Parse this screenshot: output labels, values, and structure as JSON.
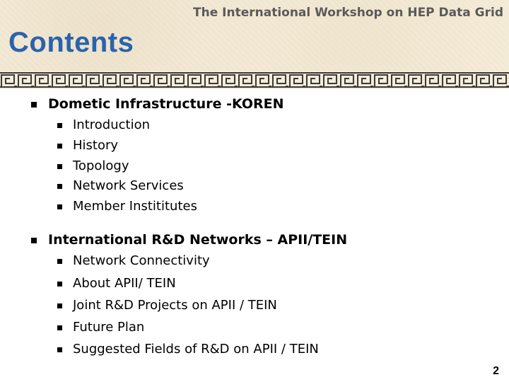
{
  "header": {
    "workshop": "The International Workshop on HEP Data Grid",
    "title": "Contents"
  },
  "sections": [
    {
      "heading": "Dometic Infrastructure -KOREN",
      "items": [
        "Introduction",
        "History",
        "Topology",
        "Network Services",
        "Member Instititutes"
      ]
    },
    {
      "heading": "International R&D Networks – APII/TEIN",
      "items": [
        "Network Connectivity",
        "About APII/ TEIN",
        "Joint R&D Projects on APII / TEIN",
        "Future Plan",
        "Suggested Fields of R&D on APII / TEIN"
      ]
    }
  ],
  "page_number": "2",
  "colors": {
    "title": "#2a63ad",
    "header_bg": "#f5ecd9",
    "border": "#3a3a3a"
  }
}
